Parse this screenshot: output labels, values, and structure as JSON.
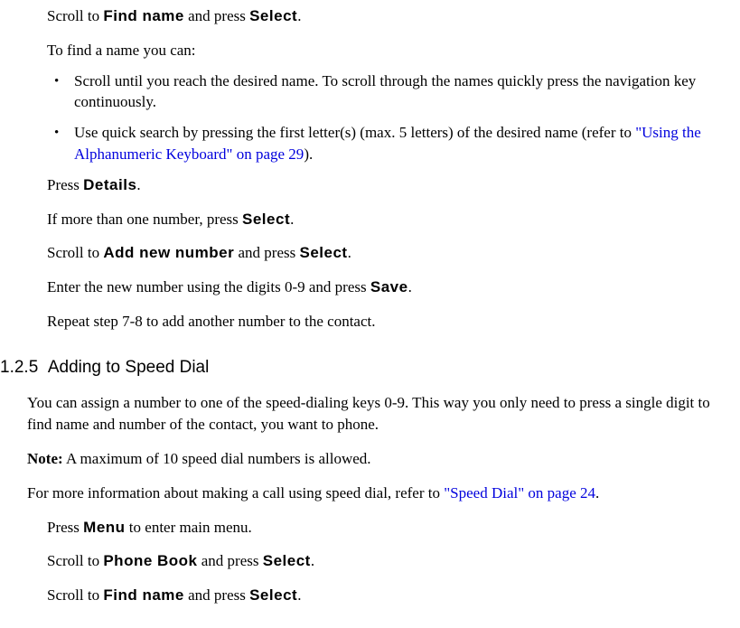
{
  "steps_a": {
    "s1_pre": "Scroll to ",
    "s1_ui1": "Find name",
    "s1_mid": " and press ",
    "s1_ui2": "Select",
    "s1_post": ".",
    "s2": "To find a name you can:",
    "b1": "Scroll until you reach the desired name. To scroll through the names quickly press the navigation key continuously.",
    "b2_pre": "Use quick search by pressing the first letter(s) (max. 5 letters) of the desired name (refer to ",
    "b2_link": "\"Using the Alphanumeric Keyboard\" on page 29",
    "b2_post": ").",
    "s3_pre": "Press ",
    "s3_ui": "Details",
    "s3_post": ".",
    "s4_pre": "If more than one number, press ",
    "s4_ui": "Select",
    "s4_post": ".",
    "s5_pre": "Scroll to ",
    "s5_ui1": "Add new number",
    "s5_mid": " and press ",
    "s5_ui2": "Select",
    "s5_post": ".",
    "s6_pre": "Enter the new number using the digits 0-9 and press ",
    "s6_ui": "Save",
    "s6_post": ".",
    "s7": "Repeat step 7-8 to add another number to the contact."
  },
  "section": {
    "number": "1.2.5",
    "title": "Adding to Speed Dial",
    "p1": "You can assign a number to one of the speed-dialing keys 0-9. This way you only need to press a single digit to find name and number of the contact, you want to phone.",
    "note_label": "Note:",
    "note_text": " A maximum of 10 speed dial numbers is allowed.",
    "p2_pre": "For more information about making a call using speed dial, refer to ",
    "p2_link": "\"Speed Dial\" on page 24",
    "p2_post": "."
  },
  "steps_b": {
    "s1_pre": "Press ",
    "s1_ui": "Menu",
    "s1_post": " to enter main menu.",
    "s2_pre": "Scroll to ",
    "s2_ui1": "Phone Book",
    "s2_mid": " and press ",
    "s2_ui2": "Select",
    "s2_post": ".",
    "s3_pre": "Scroll to ",
    "s3_ui1": "Find name",
    "s3_mid": " and press ",
    "s3_ui2": "Select",
    "s3_post": "."
  }
}
